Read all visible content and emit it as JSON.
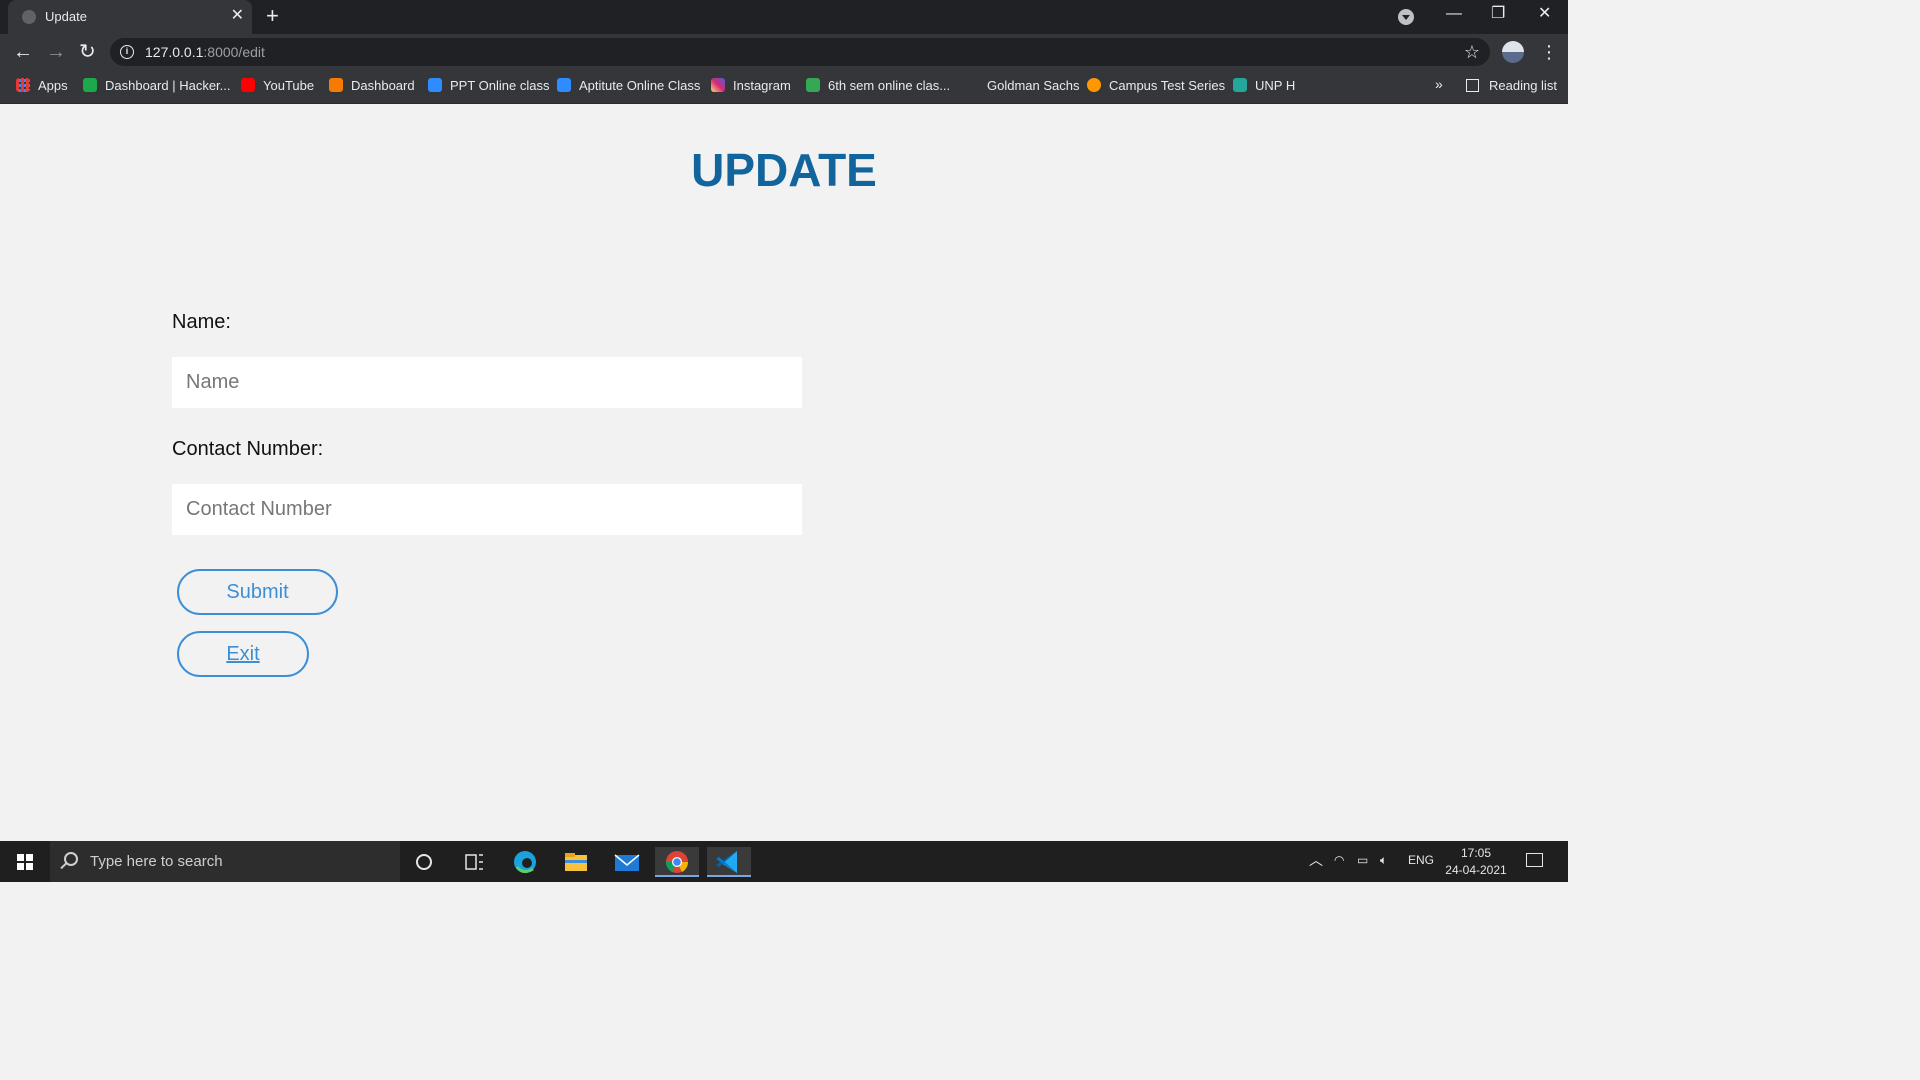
{
  "browser": {
    "tab_title": "Update",
    "url_host": "127.0.0.1",
    "url_path": ":8000/edit",
    "bookmarks": [
      {
        "label": "Apps",
        "color": "#e53935"
      },
      {
        "label": "Dashboard | Hacker...",
        "color": "#1ba94c"
      },
      {
        "label": "YouTube",
        "color": "#ff0000"
      },
      {
        "label": "Dashboard",
        "color": "#f57c00"
      },
      {
        "label": "PPT Online class",
        "color": "#2d8cff"
      },
      {
        "label": "Aptitute Online Class",
        "color": "#2d8cff"
      },
      {
        "label": "Instagram",
        "color": "#c13584"
      },
      {
        "label": "6th sem online clas...",
        "color": "#34a853"
      },
      {
        "label": "Goldman Sachs",
        "color": ""
      },
      {
        "label": "Campus Test Series",
        "color": "#ff9800"
      },
      {
        "label": "UNP H",
        "color": "#26a69a"
      }
    ],
    "reading_list": "Reading list"
  },
  "page": {
    "heading": "UPDATE",
    "name_label": "Name:",
    "name_placeholder": "Name",
    "contact_label": "Contact Number:",
    "contact_placeholder": "Contact Number",
    "submit_label": "Submit",
    "exit_label": "Exit"
  },
  "taskbar": {
    "search_placeholder": "Type here to search",
    "language": "ENG",
    "time": "17:05",
    "date": "24-04-2021"
  },
  "colors": {
    "heading": "#12659c",
    "button": "#3c8fd6",
    "page_bg": "#f2f2f2"
  }
}
